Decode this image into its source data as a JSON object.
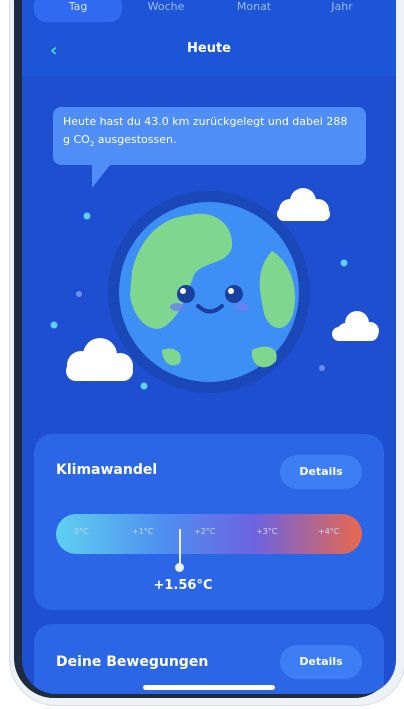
{
  "tabs": [
    {
      "label": "Tag",
      "active": true
    },
    {
      "label": "Woche",
      "active": false
    },
    {
      "label": "Monat",
      "active": false
    },
    {
      "label": "Jahr",
      "active": false
    }
  ],
  "header": {
    "title": "Heute",
    "back_icon": "chevron-left-icon"
  },
  "summary": {
    "text_before": "Heute hast du 43.0 km zurückgelegt und dabei 288 g ",
    "co2_main": "CO",
    "co2_sub": "2",
    "text_after": " ausgestossen."
  },
  "climate": {
    "title": "Klimawandel",
    "details_label": "Details",
    "scale_ticks": [
      "0°C",
      "+1°C",
      "+2°C",
      "+3°C",
      "+4°C"
    ],
    "value_label": "+1.56°C",
    "value_celsius": 1.56
  },
  "movements": {
    "title": "Deine Bewegungen",
    "details_label": "Details"
  },
  "colors": {
    "background": "#1d4fd0",
    "card": "#2a66e6",
    "accent": "#4be0c6",
    "button": "#3d7ef5"
  }
}
